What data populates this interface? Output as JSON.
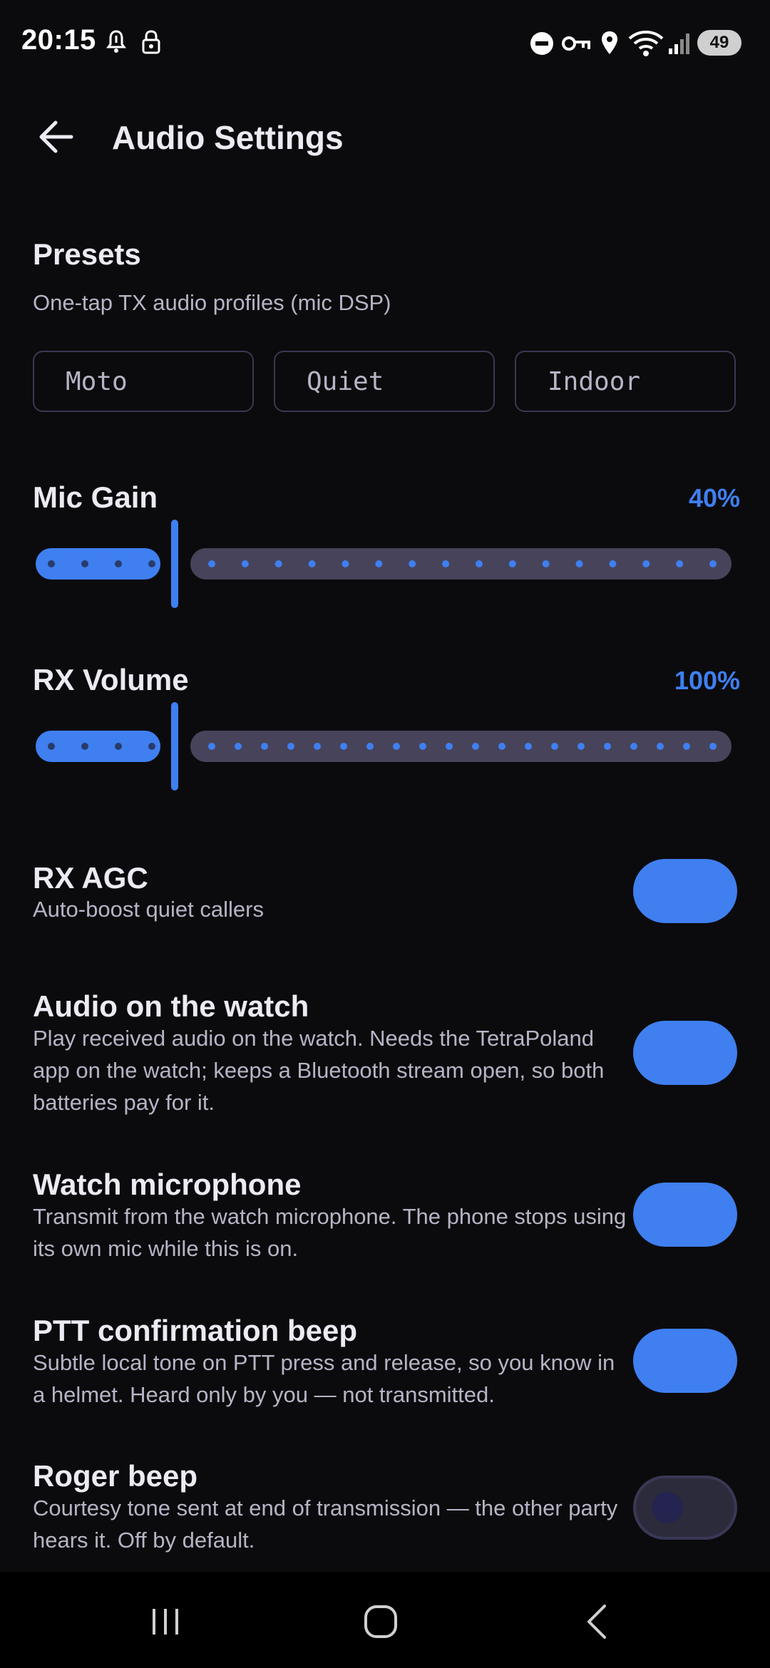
{
  "status_bar": {
    "time": "20:15",
    "battery": "49",
    "icons": [
      "notification-bell-icon",
      "lock-icon",
      "do-not-disturb-icon",
      "vpn-key-icon",
      "location-icon",
      "wifi-icon",
      "signal-icon"
    ]
  },
  "header": {
    "title": "Audio Settings",
    "back_icon": "arrow-back-icon"
  },
  "presets": {
    "title": "Presets",
    "subtitle": "One-tap TX audio profiles (mic DSP)",
    "buttons": [
      "Moto",
      "Quiet",
      "Indoor"
    ]
  },
  "sliders": [
    {
      "label": "Mic Gain",
      "value_text": "40%",
      "level": 0.4
    },
    {
      "label": "RX Volume",
      "value_text": "100%",
      "level": 1.0
    }
  ],
  "toggles": [
    {
      "title": "RX AGC",
      "description": "Auto-boost quiet callers",
      "on": true
    },
    {
      "title": "Audio on the watch",
      "description": "Play received audio on the watch. Needs the TetraPoland app on the watch; keeps a Bluetooth stream open, so both batteries pay for it.",
      "on": true
    },
    {
      "title": "Watch microphone",
      "description": "Transmit from the watch microphone. The phone stops using its own mic while this is on.",
      "on": true
    },
    {
      "title": "PTT confirmation beep",
      "description": "Subtle local tone on PTT press and release, so you know in a helmet. Heard only by you — not transmitted.",
      "on": true
    },
    {
      "title": "Roger beep",
      "description": "Courtesy tone sent at end of transmission — the other party hears it. Off by default.",
      "on": false
    }
  ],
  "nav_bar": {
    "icons": [
      "recent-apps-icon",
      "home-icon",
      "nav-back-icon"
    ]
  },
  "colors": {
    "accent": "#3f7ff0",
    "background": "#0b0b0d",
    "track": "#47435a",
    "toggle_off": "#2c2b3b"
  }
}
